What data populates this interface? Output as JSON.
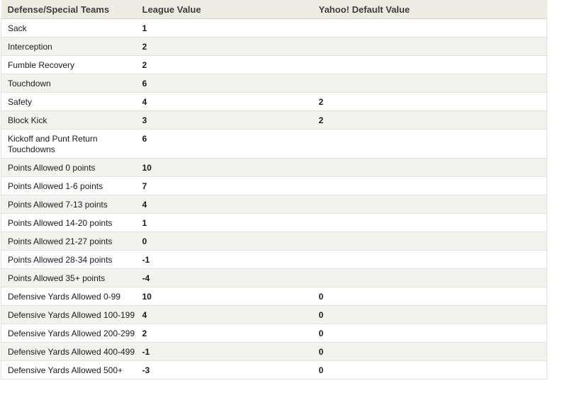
{
  "table": {
    "headers": [
      "Defense/Special Teams",
      "League Value",
      "Yahoo! Default Value"
    ],
    "rows": [
      {
        "stat": "Sack",
        "league": "1",
        "default": ""
      },
      {
        "stat": "Interception",
        "league": "2",
        "default": ""
      },
      {
        "stat": "Fumble Recovery",
        "league": "2",
        "default": ""
      },
      {
        "stat": "Touchdown",
        "league": "6",
        "default": ""
      },
      {
        "stat": "Safety",
        "league": "4",
        "default": "2"
      },
      {
        "stat": "Block Kick",
        "league": "3",
        "default": "2"
      },
      {
        "stat": "Kickoff and Punt Return Touchdowns",
        "league": "6",
        "default": ""
      },
      {
        "stat": "Points Allowed 0 points",
        "league": "10",
        "default": ""
      },
      {
        "stat": "Points Allowed 1-6 points",
        "league": "7",
        "default": ""
      },
      {
        "stat": "Points Allowed 7-13 points",
        "league": "4",
        "default": ""
      },
      {
        "stat": "Points Allowed 14-20 points",
        "league": "1",
        "default": ""
      },
      {
        "stat": "Points Allowed 21-27 points",
        "league": "0",
        "default": ""
      },
      {
        "stat": "Points Allowed 28-34 points",
        "league": "-1",
        "default": ""
      },
      {
        "stat": "Points Allowed 35+ points",
        "league": "-4",
        "default": ""
      },
      {
        "stat": "Defensive Yards Allowed 0-99",
        "league": "10",
        "default": "0"
      },
      {
        "stat": "Defensive Yards Allowed 100-199",
        "league": "4",
        "default": "0"
      },
      {
        "stat": "Defensive Yards Allowed 200-299",
        "league": "2",
        "default": "0"
      },
      {
        "stat": "Defensive Yards Allowed 400-499",
        "league": "-1",
        "default": "0"
      },
      {
        "stat": "Defensive Yards Allowed 500+",
        "league": "-3",
        "default": "0"
      }
    ]
  }
}
